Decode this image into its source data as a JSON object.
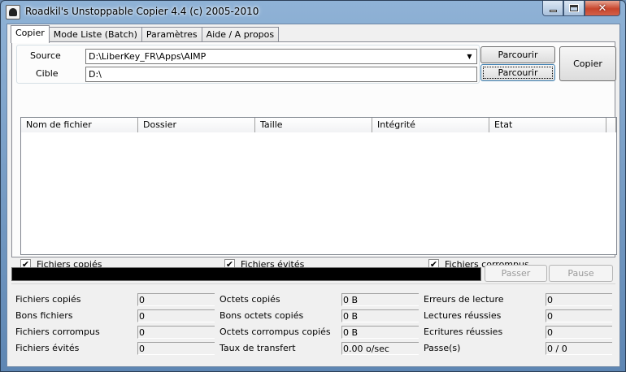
{
  "window": {
    "title": "Roadkil's Unstoppable Copier 4.4 (c) 2005-2010",
    "controls": {
      "minimize": "minimize-icon",
      "maximize": "maximize-icon",
      "close": "close-icon"
    }
  },
  "tabs": [
    {
      "label": "Copier",
      "active": true
    },
    {
      "label": "Mode Liste (Batch)",
      "active": false
    },
    {
      "label": "Paramètres",
      "active": false
    },
    {
      "label": "Aide / A propos",
      "active": false
    }
  ],
  "source": {
    "label": "Source",
    "value": "D:\\LiberKey_FR\\Apps\\AIMP"
  },
  "target": {
    "label": "Cible",
    "value": "D:\\"
  },
  "buttons": {
    "browse_source": "Parcourir",
    "browse_target": "Parcourir",
    "copy": "Copier",
    "skip": "Passer",
    "pause": "Pause"
  },
  "file_list": {
    "columns": [
      "Nom de fichier",
      "Dossier",
      "Taille",
      "Intégrité",
      "Etat"
    ],
    "rows": []
  },
  "filters": [
    {
      "label": "Fichiers copiés",
      "checked": true
    },
    {
      "label": "Fichiers évités",
      "checked": true
    },
    {
      "label": "Fichiers corrompus",
      "checked": true
    }
  ],
  "progress": {
    "value": 0
  },
  "stats": {
    "col1": [
      {
        "label": "Fichiers copiés",
        "value": "0"
      },
      {
        "label": "Bons fichiers",
        "value": "0"
      },
      {
        "label": "Fichiers corrompus",
        "value": "0"
      },
      {
        "label": "Fichiers évités",
        "value": "0"
      }
    ],
    "col2": [
      {
        "label": "Octets copiés",
        "value": "0 B"
      },
      {
        "label": "Bons octets copiés",
        "value": "0 B"
      },
      {
        "label": "Octets corrompus copiés",
        "value": "0 B"
      },
      {
        "label": "Taux de transfert",
        "value": "0.00 o/sec"
      }
    ],
    "col3": [
      {
        "label": "Erreurs de lecture",
        "value": "0"
      },
      {
        "label": "Lectures réussies",
        "value": "0"
      },
      {
        "label": "Ecritures réussies",
        "value": "0"
      },
      {
        "label": "Passe(s)",
        "value": "0 / 0"
      }
    ]
  }
}
